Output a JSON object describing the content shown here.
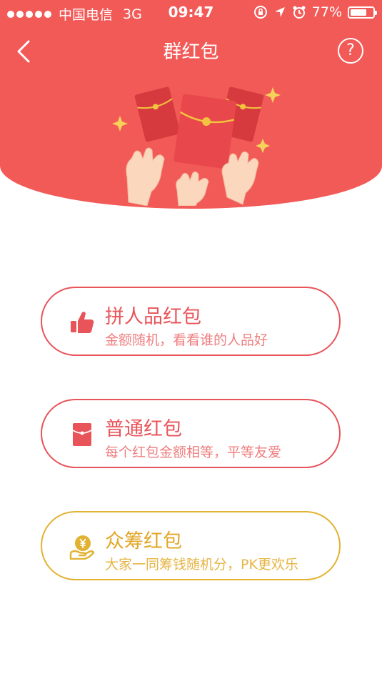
{
  "status_bar": {
    "carrier": "中国电信",
    "network": "3G",
    "time": "09:47",
    "battery": "77%",
    "battery_level": 0.77
  },
  "nav": {
    "back_icon": "chevron-left-icon",
    "title": "群红包",
    "help_glyph": "?"
  },
  "colors": {
    "header": "#f25a57",
    "red": "#e8545a",
    "gold": "#e2b232"
  },
  "options": [
    {
      "title": "拼人品红包",
      "desc": "金额随机，看看谁的人品好",
      "icon": "thumbs-up-icon"
    },
    {
      "title": "普通红包",
      "desc": "每个红包金额相等，平等友爱",
      "icon": "red-envelope-icon"
    },
    {
      "title": "众筹红包",
      "desc": "大家一同筹钱随机分，PK更欢乐",
      "icon": "yuan-coin-hand-icon"
    }
  ]
}
